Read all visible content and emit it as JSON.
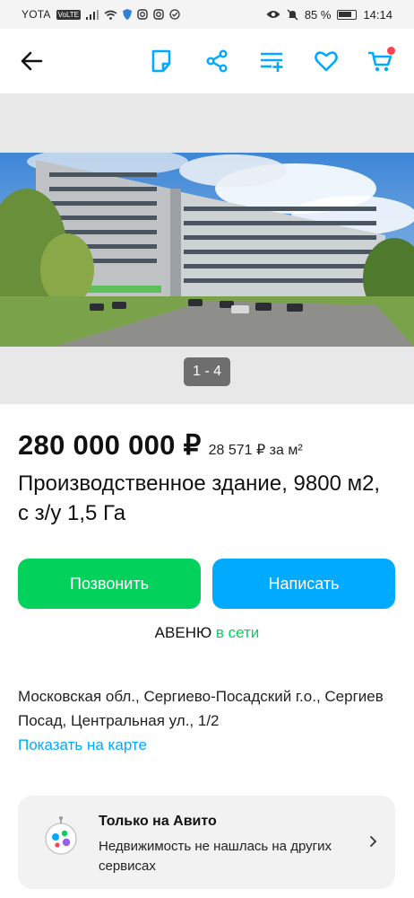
{
  "status_bar": {
    "carrier": "YOTA",
    "volte": "VoLTE",
    "battery": "85 %",
    "time": "14:14"
  },
  "header": {
    "icons": [
      "back-arrow-icon",
      "note-icon",
      "share-icon",
      "compare-icon",
      "heart-icon",
      "cart-icon"
    ],
    "accent": "#00aaff",
    "cart_badge_color": "#ff4053"
  },
  "gallery": {
    "counter": "1 - 4"
  },
  "listing": {
    "price": "280 000 000 ₽",
    "price_per": "28 571 ₽ за м²",
    "title": "Производственное здание, 9800 м2, с з/у 1,5 Га"
  },
  "actions": {
    "call_label": "Позвонить",
    "call_color": "#02d15c",
    "write_label": "Написать",
    "write_color": "#00aaff"
  },
  "seller": {
    "name": "АВЕНЮ",
    "status": "в сети"
  },
  "location": {
    "address": "Московская обл., Сергиево-Посадский г.о., Сергиев Посад, Центральная ул., 1/2",
    "map_link": "Показать на карте"
  },
  "promo": {
    "title": "Только на Авито",
    "text": "Недвижимость не нашлась на других сервисах"
  }
}
